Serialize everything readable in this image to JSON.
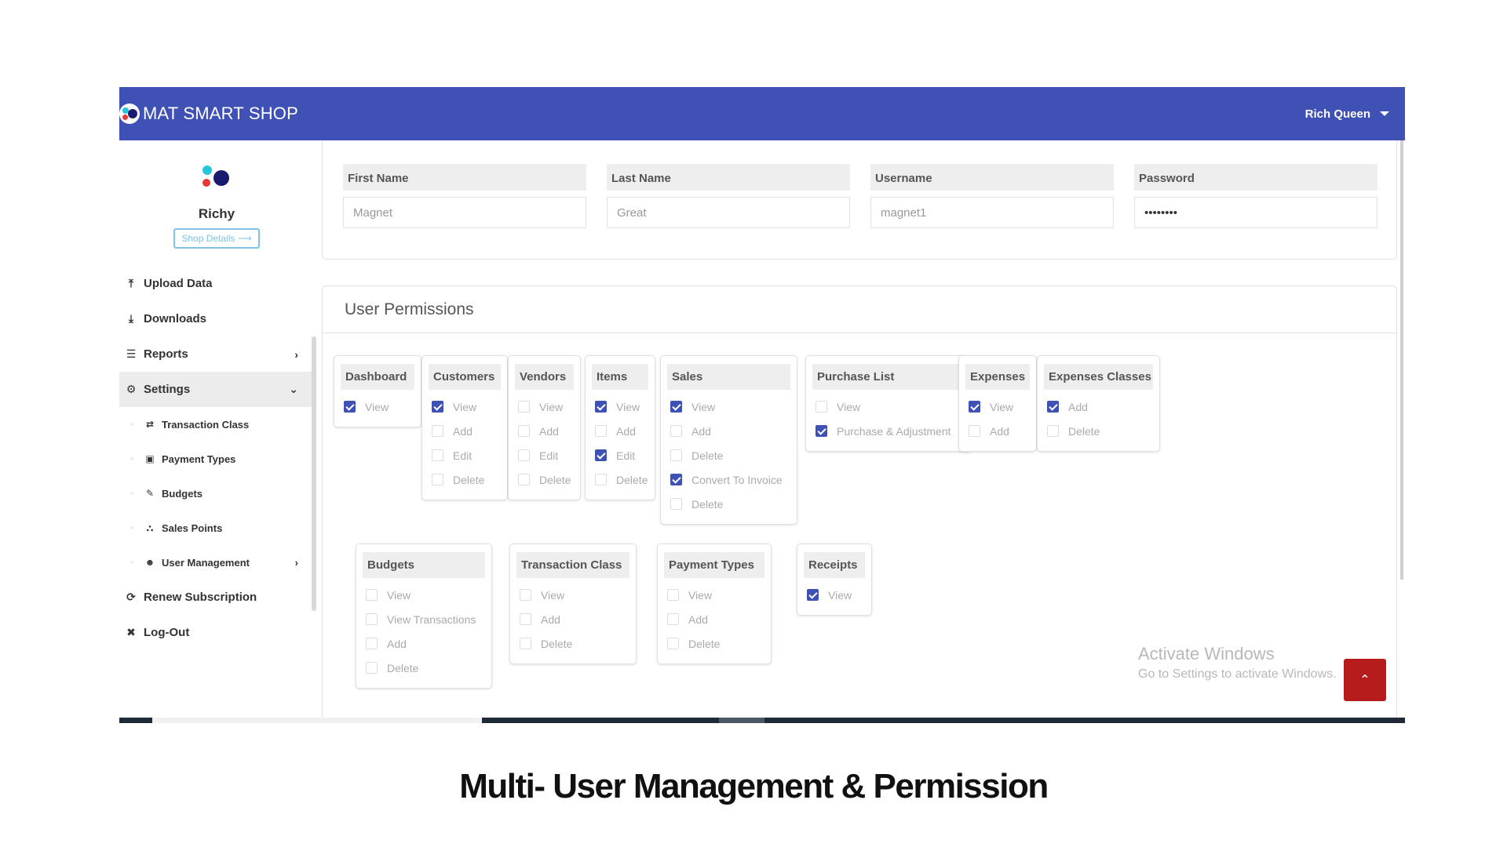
{
  "app": {
    "brand": "MAT SMART SHOP",
    "user_name": "Rich Queen"
  },
  "profile": {
    "name": "Richy",
    "shop_details_label": "Shop Details"
  },
  "sidebar": {
    "items": [
      {
        "label": "Upload Data",
        "icon": "upload-icon"
      },
      {
        "label": "Downloads",
        "icon": "download-icon"
      },
      {
        "label": "Reports",
        "icon": "list-icon"
      },
      {
        "label": "Settings",
        "icon": "gear-icon"
      }
    ],
    "settings_children": [
      {
        "label": "Transaction Class",
        "icon": "exchange-icon"
      },
      {
        "label": "Payment Types",
        "icon": "money-icon"
      },
      {
        "label": "Budgets",
        "icon": "edit-icon"
      },
      {
        "label": "Sales Points",
        "icon": "cart-icon"
      },
      {
        "label": "User Management",
        "icon": "users-icon"
      }
    ],
    "bottom_items": [
      {
        "label": "Renew Subscription",
        "icon": "refresh-icon"
      },
      {
        "label": "Log-Out",
        "icon": "close-icon"
      }
    ]
  },
  "user_form": {
    "first_name": {
      "label": "First Name",
      "value": "Magnet"
    },
    "last_name": {
      "label": "Last Name",
      "value": "Great"
    },
    "username": {
      "label": "Username",
      "value": "magnet1"
    },
    "password": {
      "label": "Password",
      "value": "••••••••"
    }
  },
  "permissions": {
    "title": "User Permissions",
    "groups": [
      {
        "title": "Dashboard",
        "perms": [
          {
            "label": "View",
            "checked": true
          }
        ]
      },
      {
        "title": "Customers",
        "perms": [
          {
            "label": "View",
            "checked": true
          },
          {
            "label": "Add",
            "checked": false
          },
          {
            "label": "Edit",
            "checked": false
          },
          {
            "label": "Delete",
            "checked": false
          }
        ]
      },
      {
        "title": "Vendors",
        "perms": [
          {
            "label": "View",
            "checked": false
          },
          {
            "label": "Add",
            "checked": false
          },
          {
            "label": "Edit",
            "checked": false
          },
          {
            "label": "Delete",
            "checked": false
          }
        ]
      },
      {
        "title": "Items",
        "perms": [
          {
            "label": "View",
            "checked": true
          },
          {
            "label": "Add",
            "checked": false
          },
          {
            "label": "Edit",
            "checked": true
          },
          {
            "label": "Delete",
            "checked": false
          }
        ]
      },
      {
        "title": "Sales",
        "perms": [
          {
            "label": "View",
            "checked": true
          },
          {
            "label": "Add",
            "checked": false
          },
          {
            "label": "Delete",
            "checked": false
          },
          {
            "label": "Convert To Invoice",
            "checked": true
          },
          {
            "label": "Delete",
            "checked": false
          }
        ]
      },
      {
        "title": "Purchase List",
        "perms": [
          {
            "label": "View",
            "checked": false
          },
          {
            "label": "Purchase & Adjustment",
            "checked": true
          }
        ]
      },
      {
        "title": "Expenses",
        "perms": [
          {
            "label": "View",
            "checked": true
          },
          {
            "label": "Add",
            "checked": false
          }
        ]
      },
      {
        "title": "Expenses Classes",
        "perms": [
          {
            "label": "Add",
            "checked": true
          },
          {
            "label": "Delete",
            "checked": false
          }
        ]
      },
      {
        "title": "Budgets",
        "perms": [
          {
            "label": "View",
            "checked": false
          },
          {
            "label": "View Transactions",
            "checked": false
          },
          {
            "label": "Add",
            "checked": false
          },
          {
            "label": "Delete",
            "checked": false
          }
        ]
      },
      {
        "title": "Transaction Class",
        "perms": [
          {
            "label": "View",
            "checked": false
          },
          {
            "label": "Add",
            "checked": false
          },
          {
            "label": "Delete",
            "checked": false
          }
        ]
      },
      {
        "title": "Payment Types",
        "perms": [
          {
            "label": "View",
            "checked": false
          },
          {
            "label": "Add",
            "checked": false
          },
          {
            "label": "Delete",
            "checked": false
          }
        ]
      },
      {
        "title": "Receipts",
        "perms": [
          {
            "label": "View",
            "checked": true
          }
        ]
      }
    ]
  },
  "watermark": {
    "line1": "Activate Windows",
    "line2": "Go to Settings to activate Windows."
  },
  "caption": "Multi- User Management & Permission",
  "colors": {
    "primary": "#3f51b5",
    "scroll_top_button": "#b71c1c",
    "outline_button": "#7ec3e6"
  }
}
